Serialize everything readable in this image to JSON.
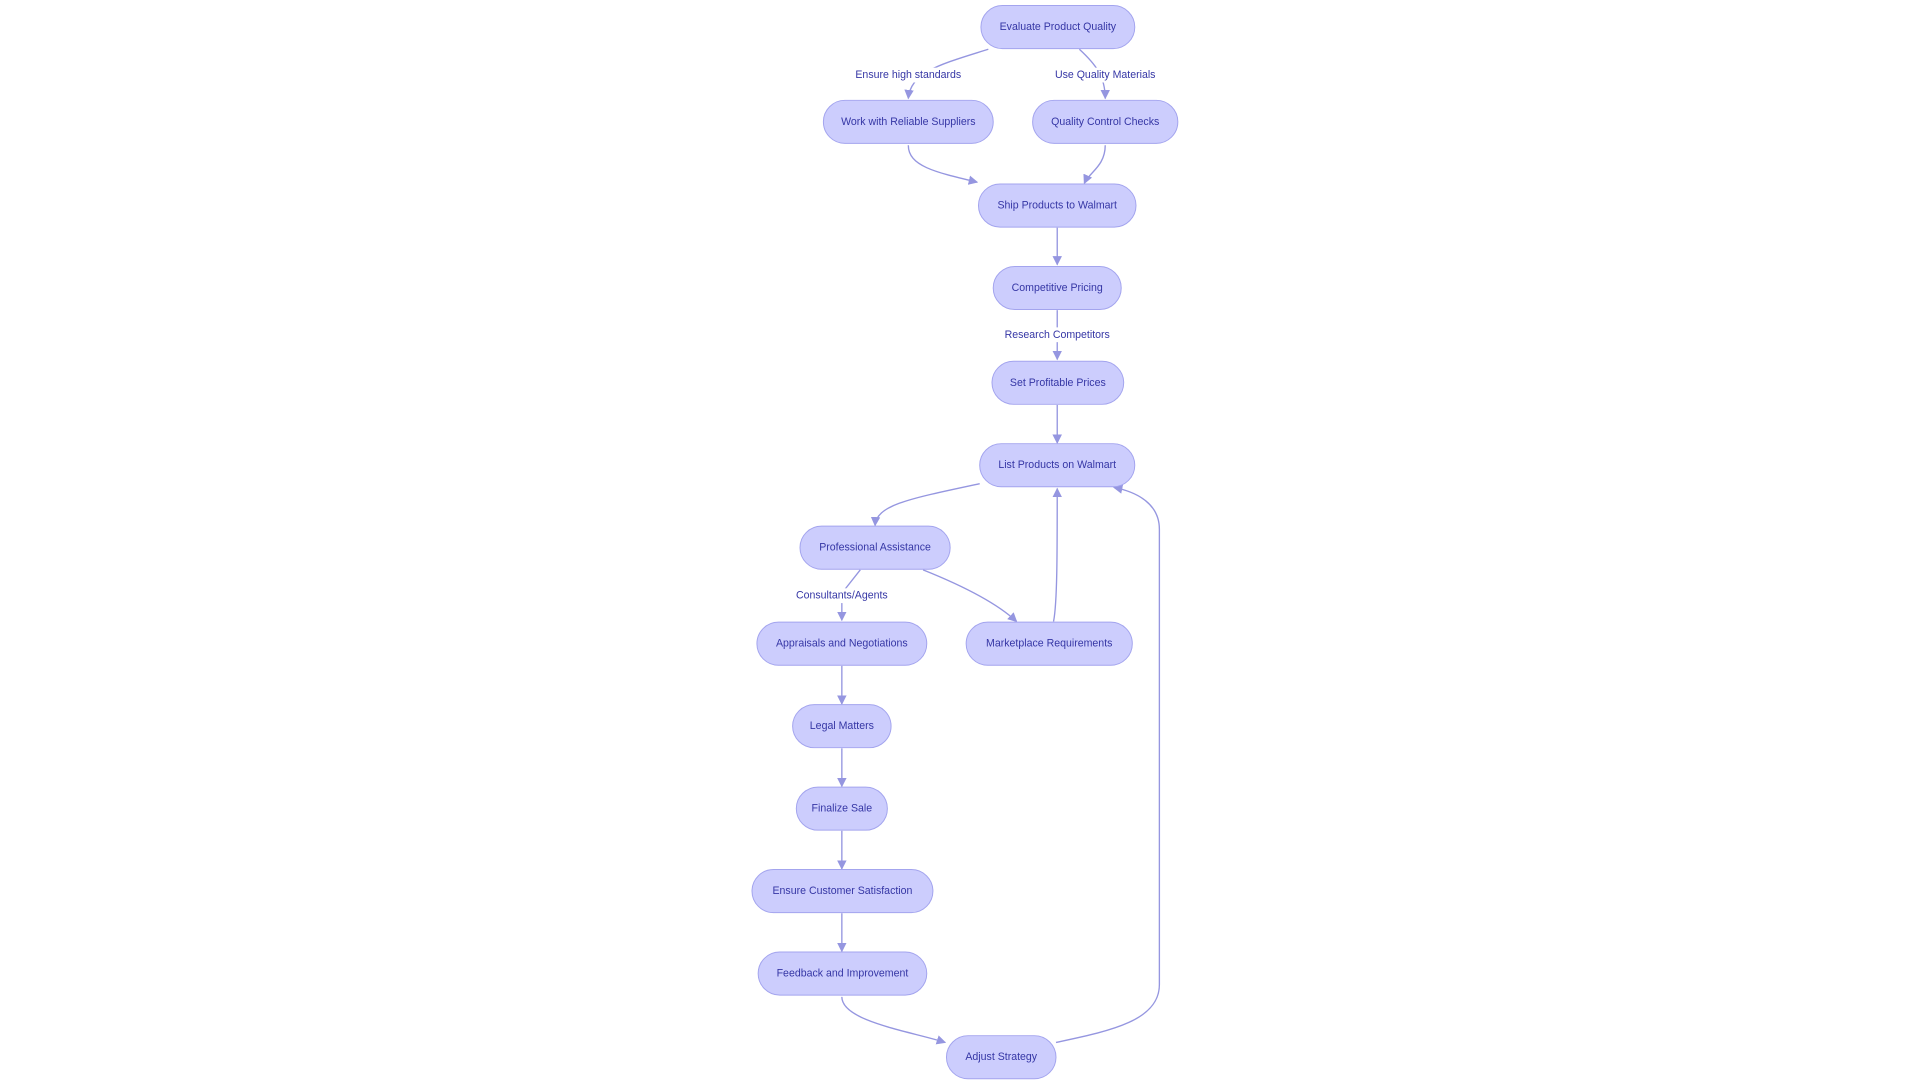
{
  "colors": {
    "node_fill": "#cccdfd",
    "node_stroke": "#a3a4ee",
    "text": "#3536a5",
    "edge": "#9596e0"
  },
  "nodes": [
    "Evaluate Product Quality",
    "Work with Reliable Suppliers",
    "Quality Control Checks",
    "Ship Products to Walmart",
    "Competitive Pricing",
    "Set Profitable Prices",
    "List Products on Walmart",
    "Professional Assistance",
    "Appraisals and Negotiations",
    "Marketplace Requirements",
    "Legal Matters",
    "Finalize Sale",
    "Ensure Customer Satisfaction",
    "Feedback and Improvement",
    "Adjust Strategy"
  ],
  "edge_labels": {
    "ensure_high_standards": "Ensure high standards",
    "use_quality_materials": "Use Quality Materials",
    "research_competitors": "Research Competitors",
    "consultants_agents": "Consultants/Agents"
  }
}
